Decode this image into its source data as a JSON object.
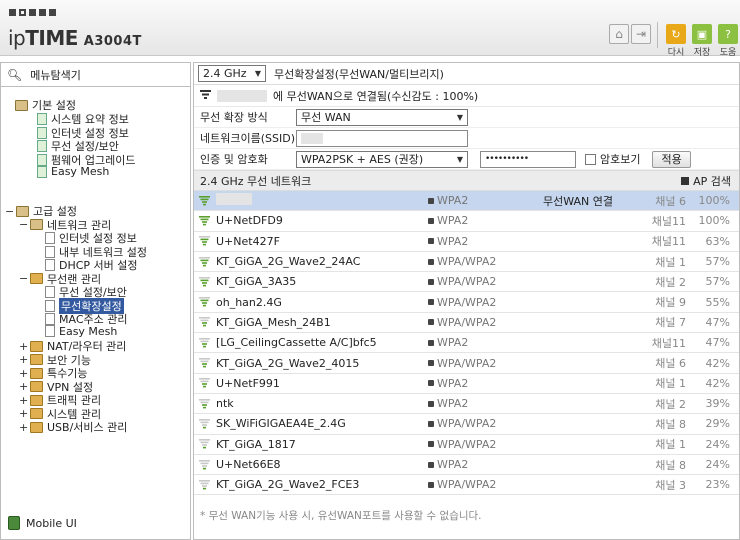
{
  "header": {
    "brand_light": "ip",
    "brand_bold": "TIME",
    "model": "A3004T",
    "tools": [
      {
        "label": "다시",
        "icon": "refresh-icon",
        "color": "#e8a818"
      },
      {
        "label": "저장",
        "icon": "save-icon",
        "color": "#8cc040"
      },
      {
        "label": "도움",
        "icon": "help-icon",
        "color": "#8cc040"
      }
    ]
  },
  "sidebar": {
    "title": "메뉴탐색기",
    "basic": {
      "label": "기본 설정",
      "items": [
        "시스템 요약 정보",
        "인터넷 설정 정보",
        "무선 설정/보안",
        "펌웨어 업그레이드",
        "Easy Mesh"
      ]
    },
    "advanced": {
      "label": "고급 설정",
      "network": {
        "label": "네트워크 관리",
        "items": [
          "인터넷 설정 정보",
          "내부 네트워크 설정",
          "DHCP 서버 설정"
        ]
      },
      "wireless": {
        "label": "무선랜 관리",
        "items": [
          "무선 설정/보안",
          "무선확장설정",
          "MAC주소 관리",
          "Easy Mesh"
        ]
      },
      "others": [
        "NAT/라우터 관리",
        "보안 기능",
        "특수기능",
        "VPN 설정",
        "트래픽 관리",
        "시스템 관리",
        "USB/서비스 관리"
      ]
    },
    "mobile": "Mobile UI"
  },
  "main": {
    "band": "2.4 GHz",
    "title": "무선확장설정(무선WAN/멀티브리지)",
    "connected_text": "에 무선WAN으로 연결됨(수신감도 : 100%)",
    "mode_label": "무선 확장 방식",
    "mode_value": "무선 WAN",
    "ssid_label": "네트워크이름(SSID)",
    "auth_label": "인증 및 암호화",
    "auth_value": "WPA2PSK + AES (권장)",
    "password": "••••••••••",
    "show_password": "암호보기",
    "apply": "적용",
    "section_title": "2.4 GHz 무선 네트워크",
    "ap_search": "AP 검색",
    "networks": [
      {
        "ssid": "",
        "security": "WPA2",
        "status": "무선WAN 연결",
        "channel": "채널 6",
        "signal": "100%",
        "selected": true,
        "strength": 4
      },
      {
        "ssid": "U+NetDFD9",
        "security": "WPA2",
        "status": "",
        "channel": "채널11",
        "signal": "100%",
        "strength": 4
      },
      {
        "ssid": "U+Net427F",
        "security": "WPA2",
        "status": "",
        "channel": "채널11",
        "signal": "63%",
        "strength": 3
      },
      {
        "ssid": "KT_GiGA_2G_Wave2_24AC",
        "security": "WPA/WPA2",
        "status": "",
        "channel": "채널 1",
        "signal": "57%",
        "strength": 3
      },
      {
        "ssid": "KT_GiGA_3A35",
        "security": "WPA/WPA2",
        "status": "",
        "channel": "채널 2",
        "signal": "57%",
        "strength": 3
      },
      {
        "ssid": "oh_han2.4G",
        "security": "WPA/WPA2",
        "status": "",
        "channel": "채널 9",
        "signal": "55%",
        "strength": 3
      },
      {
        "ssid": "KT_GiGA_Mesh_24B1",
        "security": "WPA/WPA2",
        "status": "",
        "channel": "채널 7",
        "signal": "47%",
        "strength": 2
      },
      {
        "ssid": "[LG_CeilingCassette A/C]bfc5",
        "security": "WPA2",
        "status": "",
        "channel": "채널11",
        "signal": "47%",
        "strength": 2
      },
      {
        "ssid": "KT_GiGA_2G_Wave2_4015",
        "security": "WPA/WPA2",
        "status": "",
        "channel": "채널 6",
        "signal": "42%",
        "strength": 2
      },
      {
        "ssid": "U+NetF991",
        "security": "WPA2",
        "status": "",
        "channel": "채널 1",
        "signal": "42%",
        "strength": 2
      },
      {
        "ssid": "ntk",
        "security": "WPA2",
        "status": "",
        "channel": "채널 2",
        "signal": "39%",
        "strength": 2
      },
      {
        "ssid": "SK_WiFiGIGAEA4E_2.4G",
        "security": "WPA/WPA2",
        "status": "",
        "channel": "채널 8",
        "signal": "29%",
        "strength": 1
      },
      {
        "ssid": "KT_GiGA_1817",
        "security": "WPA/WPA2",
        "status": "",
        "channel": "채널 1",
        "signal": "24%",
        "strength": 1
      },
      {
        "ssid": "U+Net66E8",
        "security": "WPA2",
        "status": "",
        "channel": "채널 8",
        "signal": "24%",
        "strength": 1
      },
      {
        "ssid": "KT_GiGA_2G_Wave2_FCE3",
        "security": "WPA/WPA2",
        "status": "",
        "channel": "채널 3",
        "signal": "23%",
        "strength": 1
      }
    ],
    "note": "* 무선 WAN기능 사용 시, 유선WAN포트를 사용할 수 없습니다."
  },
  "colors": {
    "signal_green": "#5aa02c",
    "signal_gray": "#c8c8c8",
    "selected_row": "#c5d6ee"
  }
}
